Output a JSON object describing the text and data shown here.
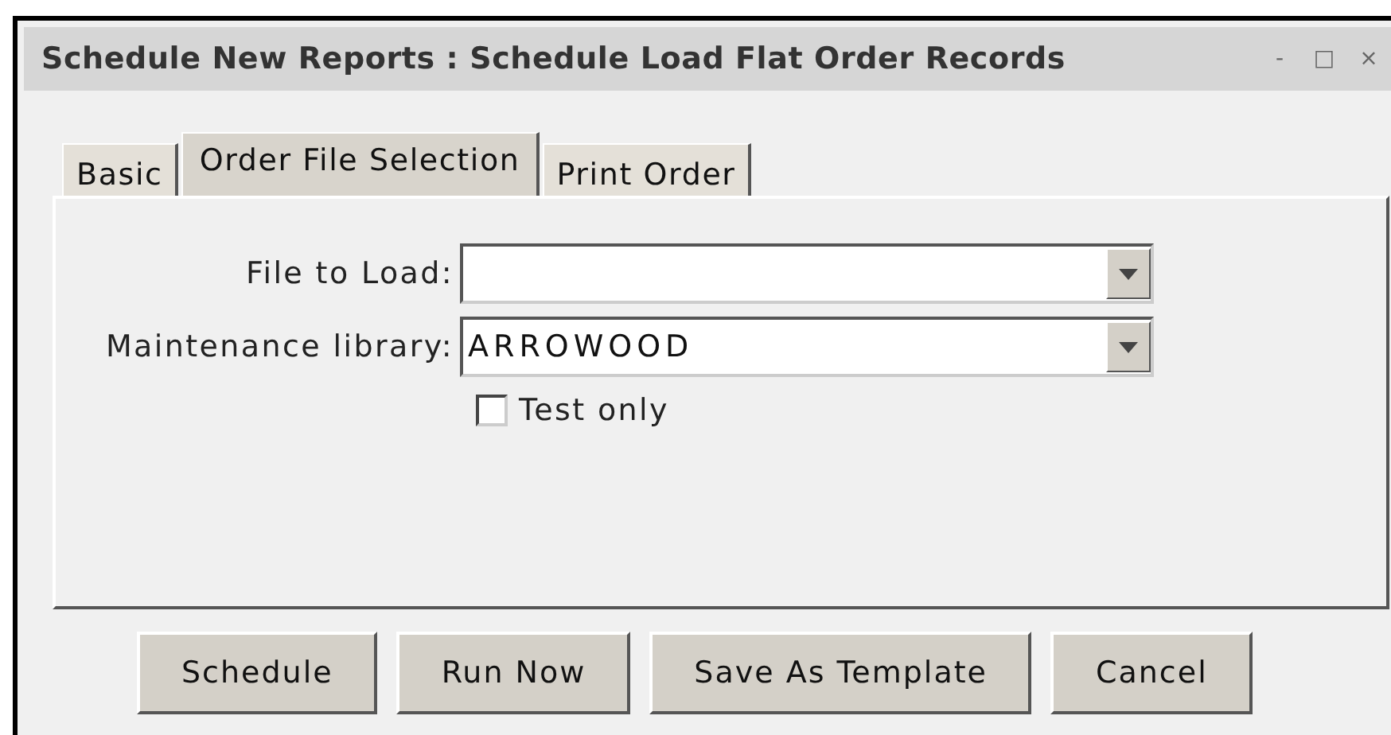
{
  "window": {
    "title": "Schedule New Reports : Schedule Load Flat Order Records",
    "controls": [
      "-",
      "□",
      "×"
    ]
  },
  "tabs": [
    {
      "label": "Basic",
      "selected": false
    },
    {
      "label": "Order File Selection",
      "selected": true
    },
    {
      "label": "Print Order",
      "selected": false
    }
  ],
  "fields": [
    {
      "label": "File to Load:"
    },
    {
      "label": "Maintenance library:",
      "value": "ARROWOOD"
    }
  ],
  "test_only": {
    "label": "Test only",
    "checked": false
  },
  "buttons": [
    "Schedule",
    "Run Now",
    "Save As Template",
    "Cancel"
  ]
}
